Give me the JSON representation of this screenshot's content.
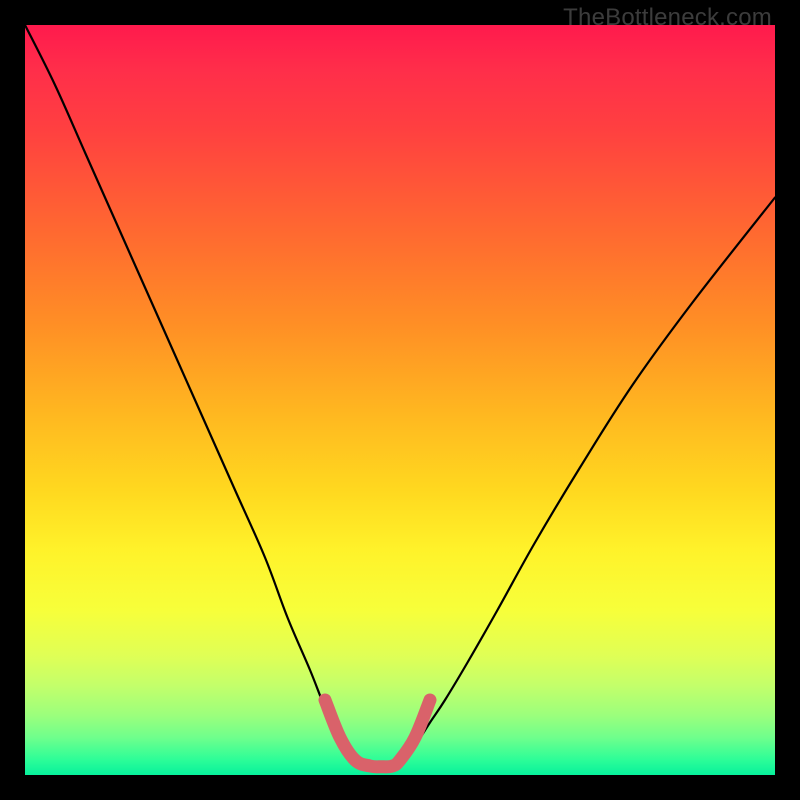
{
  "watermark": "TheBottleneck.com",
  "colors": {
    "background_frame": "#000000",
    "gradient_stops": [
      "#ff1a4d",
      "#ff4040",
      "#ff8f25",
      "#ffd81f",
      "#fff22a",
      "#c4ff6a",
      "#2cfd98",
      "#07f19c"
    ],
    "curve_stroke": "#000000",
    "highlight_stroke": "#d9626a"
  },
  "chart_data": {
    "type": "line",
    "title": "",
    "xlabel": "",
    "ylabel": "",
    "xlim": [
      0,
      100
    ],
    "ylim": [
      0,
      100
    ],
    "annotations": [],
    "series": [
      {
        "name": "left-curve",
        "x": [
          0,
          4,
          8,
          12,
          16,
          20,
          24,
          28,
          32,
          35,
          38,
          40,
          42,
          44
        ],
        "y": [
          100,
          92,
          83,
          74,
          65,
          56,
          47,
          38,
          29,
          21,
          14,
          9,
          5,
          2
        ]
      },
      {
        "name": "right-curve",
        "x": [
          50,
          52,
          54,
          56,
          59,
          63,
          68,
          74,
          81,
          89,
          100
        ],
        "y": [
          2,
          4,
          7,
          10,
          15,
          22,
          31,
          41,
          52,
          63,
          77
        ]
      },
      {
        "name": "bottom-highlight",
        "x": [
          40,
          42,
          44,
          46,
          47.5,
          49,
          50,
          52,
          54
        ],
        "y": [
          10,
          5,
          2,
          1.2,
          1.1,
          1.2,
          2,
          5,
          10
        ]
      }
    ]
  }
}
